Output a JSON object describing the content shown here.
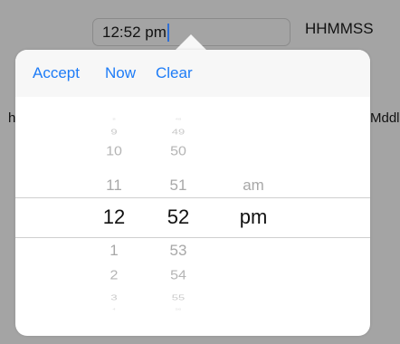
{
  "input": {
    "value": "12:52 pm"
  },
  "format_label": "HHMMSS",
  "background": {
    "left_fragment": "h",
    "right_fragment": "Mddl"
  },
  "toolbar": {
    "accept": "Accept",
    "now": "Now",
    "clear": "Clear"
  },
  "picker": {
    "hours": [
      "8",
      "9",
      "10",
      "11",
      "12",
      "1",
      "2",
      "3",
      "4"
    ],
    "minutes": [
      "48",
      "49",
      "50",
      "51",
      "52",
      "53",
      "54",
      "55",
      "56"
    ],
    "period": [
      "am",
      "pm"
    ],
    "selected": {
      "hour": "12",
      "minute": "52",
      "period": "pm"
    }
  }
}
